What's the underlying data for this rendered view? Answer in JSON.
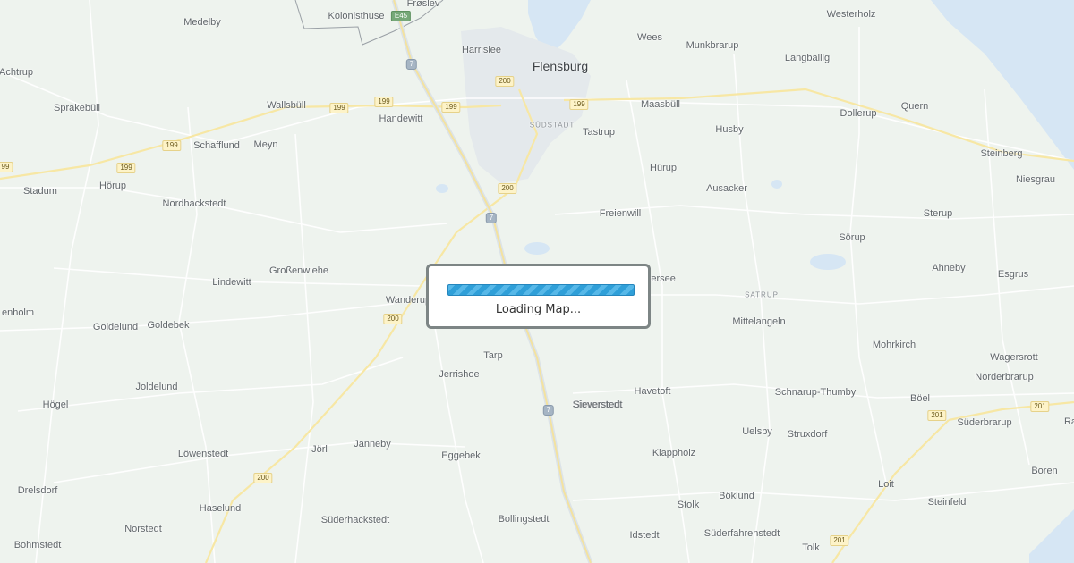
{
  "map": {
    "colors": {
      "land": "#eef3ee",
      "water": "#d6e6f4",
      "urban": "#e3e8ea",
      "road": "#ffffff",
      "highway": "#f7e7a4",
      "border": "#9aa0a6"
    },
    "labels": [
      {
        "text": "Frøslev",
        "kind": "place"
      },
      {
        "text": "Kolonisthuse",
        "kind": "place"
      },
      {
        "text": "Medelby",
        "kind": "place"
      },
      {
        "text": "Harrislee",
        "kind": "place"
      },
      {
        "text": "Flensburg",
        "kind": "city"
      },
      {
        "text": "Wees",
        "kind": "place"
      },
      {
        "text": "Munkbrarup",
        "kind": "place"
      },
      {
        "text": "Westerholz",
        "kind": "place"
      },
      {
        "text": "Langballig",
        "kind": "place"
      },
      {
        "text": "Achtrup",
        "kind": "place"
      },
      {
        "text": "Sprakebüll",
        "kind": "place"
      },
      {
        "text": "Wallsbüll",
        "kind": "place"
      },
      {
        "text": "Handewitt",
        "kind": "place"
      },
      {
        "text": "SÜDSTADT",
        "kind": "district"
      },
      {
        "text": "Maasbüll",
        "kind": "place"
      },
      {
        "text": "Tastrup",
        "kind": "place"
      },
      {
        "text": "Dollerup",
        "kind": "place"
      },
      {
        "text": "Quern",
        "kind": "place"
      },
      {
        "text": "Schafflund",
        "kind": "place"
      },
      {
        "text": "Meyn",
        "kind": "place"
      },
      {
        "text": "Husby",
        "kind": "place"
      },
      {
        "text": "Steinberg",
        "kind": "place"
      },
      {
        "text": "Stadum",
        "kind": "place"
      },
      {
        "text": "Hörup",
        "kind": "place"
      },
      {
        "text": "Hürup",
        "kind": "place"
      },
      {
        "text": "Niesgrau",
        "kind": "place"
      },
      {
        "text": "Ausacker",
        "kind": "place"
      },
      {
        "text": "Nordhackstedt",
        "kind": "place"
      },
      {
        "text": "Freienwill",
        "kind": "place"
      },
      {
        "text": "Sterup",
        "kind": "place"
      },
      {
        "text": "Sörup",
        "kind": "place"
      },
      {
        "text": "Ahneby",
        "kind": "place"
      },
      {
        "text": "Großenwiehe",
        "kind": "place"
      },
      {
        "text": "Esgrus",
        "kind": "place"
      },
      {
        "text": "Lindewitt",
        "kind": "place"
      },
      {
        "text": "Wanderup",
        "kind": "place"
      },
      {
        "text": "Oeversee",
        "kind": "place"
      },
      {
        "text": "Sieverstedt",
        "kind": "place"
      },
      {
        "text": "SATRUP",
        "kind": "district"
      },
      {
        "text": "enholm",
        "kind": "place"
      },
      {
        "text": "Mittelangeln",
        "kind": "place"
      },
      {
        "text": "Goldelund",
        "kind": "place"
      },
      {
        "text": "Goldebek",
        "kind": "place"
      },
      {
        "text": "Mohrkirch",
        "kind": "place"
      },
      {
        "text": "Tarp",
        "kind": "place"
      },
      {
        "text": "Wagersrott",
        "kind": "place"
      },
      {
        "text": "Jerrishoe",
        "kind": "place"
      },
      {
        "text": "Norderbrarup",
        "kind": "place"
      },
      {
        "text": "Joldelund",
        "kind": "place"
      },
      {
        "text": "Havetoft",
        "kind": "place"
      },
      {
        "text": "Schnarup-Thumby",
        "kind": "place"
      },
      {
        "text": "Böel",
        "kind": "place"
      },
      {
        "text": "Högel",
        "kind": "place"
      },
      {
        "text": "Sieverstedt",
        "kind": "place"
      },
      {
        "text": "Süderbrarup",
        "kind": "place"
      },
      {
        "text": "Ra",
        "kind": "place"
      },
      {
        "text": "Uelsby",
        "kind": "place"
      },
      {
        "text": "Struxdorf",
        "kind": "place"
      },
      {
        "text": "Janneby",
        "kind": "place"
      },
      {
        "text": "Jörl",
        "kind": "place"
      },
      {
        "text": "Löwenstedt",
        "kind": "place"
      },
      {
        "text": "Eggebek",
        "kind": "place"
      },
      {
        "text": "Klappholz",
        "kind": "place"
      },
      {
        "text": "Boren",
        "kind": "place"
      },
      {
        "text": "Drelsdorf",
        "kind": "place"
      },
      {
        "text": "Loit",
        "kind": "place"
      },
      {
        "text": "Haselund",
        "kind": "place"
      },
      {
        "text": "Böklund",
        "kind": "place"
      },
      {
        "text": "Steinfeld",
        "kind": "place"
      },
      {
        "text": "Stolk",
        "kind": "place"
      },
      {
        "text": "Süderhackstedt",
        "kind": "place"
      },
      {
        "text": "Bollingstedt",
        "kind": "place"
      },
      {
        "text": "Norstedt",
        "kind": "place"
      },
      {
        "text": "Idstedt",
        "kind": "place"
      },
      {
        "text": "Süderfahrenstedt",
        "kind": "place"
      },
      {
        "text": "Tolk",
        "kind": "place"
      },
      {
        "text": "Bohmstedt",
        "kind": "place"
      }
    ],
    "shields": [
      {
        "text": "E45",
        "kind": "euro"
      },
      {
        "text": "7",
        "kind": "motor"
      },
      {
        "text": "200",
        "kind": "road"
      },
      {
        "text": "199",
        "kind": "road"
      },
      {
        "text": "199",
        "kind": "road"
      },
      {
        "text": "199",
        "kind": "road"
      },
      {
        "text": "199",
        "kind": "road"
      },
      {
        "text": "199",
        "kind": "road"
      },
      {
        "text": "99",
        "kind": "road"
      },
      {
        "text": "199",
        "kind": "road"
      },
      {
        "text": "200",
        "kind": "road"
      },
      {
        "text": "7",
        "kind": "motor"
      },
      {
        "text": "200",
        "kind": "road"
      },
      {
        "text": "7",
        "kind": "motor"
      },
      {
        "text": "201",
        "kind": "road"
      },
      {
        "text": "201",
        "kind": "road"
      },
      {
        "text": "200",
        "kind": "road"
      },
      {
        "text": "201",
        "kind": "road"
      }
    ]
  },
  "loading": {
    "text": "Loading Map..."
  }
}
